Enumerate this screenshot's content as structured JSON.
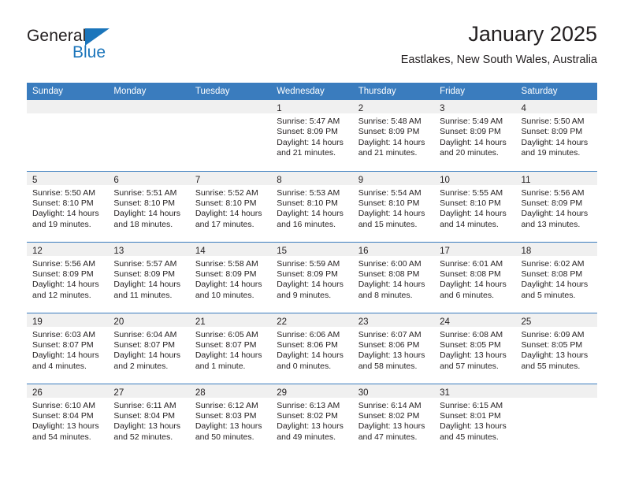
{
  "brand": {
    "name_top": "General",
    "name_bottom": "Blue",
    "accent_color": "#1b75bb",
    "triangle_icon": "triangle-icon"
  },
  "header": {
    "title": "January 2025",
    "subtitle": "Eastlakes, New South Wales, Australia"
  },
  "theme": {
    "header_row_bg": "#3a7cbe",
    "daynum_strip_bg": "#f0f0f0",
    "text_color": "#231f20",
    "row_divider": "#3a7cbe"
  },
  "weekday_headers": [
    "Sunday",
    "Monday",
    "Tuesday",
    "Wednesday",
    "Thursday",
    "Friday",
    "Saturday"
  ],
  "labels": {
    "sunrise_prefix": "Sunrise:",
    "sunset_prefix": "Sunset:",
    "daylight_prefix": "Daylight:"
  },
  "weeks": [
    [
      {
        "day": "",
        "empty": true,
        "lines": []
      },
      {
        "day": "",
        "empty": true,
        "lines": []
      },
      {
        "day": "",
        "empty": true,
        "lines": []
      },
      {
        "day": "1",
        "empty": false,
        "lines": [
          "Sunrise: 5:47 AM",
          "Sunset: 8:09 PM",
          "Daylight: 14 hours",
          "and 21 minutes."
        ]
      },
      {
        "day": "2",
        "empty": false,
        "lines": [
          "Sunrise: 5:48 AM",
          "Sunset: 8:09 PM",
          "Daylight: 14 hours",
          "and 21 minutes."
        ]
      },
      {
        "day": "3",
        "empty": false,
        "lines": [
          "Sunrise: 5:49 AM",
          "Sunset: 8:09 PM",
          "Daylight: 14 hours",
          "and 20 minutes."
        ]
      },
      {
        "day": "4",
        "empty": false,
        "lines": [
          "Sunrise: 5:50 AM",
          "Sunset: 8:09 PM",
          "Daylight: 14 hours",
          "and 19 minutes."
        ]
      }
    ],
    [
      {
        "day": "5",
        "empty": false,
        "lines": [
          "Sunrise: 5:50 AM",
          "Sunset: 8:10 PM",
          "Daylight: 14 hours",
          "and 19 minutes."
        ]
      },
      {
        "day": "6",
        "empty": false,
        "lines": [
          "Sunrise: 5:51 AM",
          "Sunset: 8:10 PM",
          "Daylight: 14 hours",
          "and 18 minutes."
        ]
      },
      {
        "day": "7",
        "empty": false,
        "lines": [
          "Sunrise: 5:52 AM",
          "Sunset: 8:10 PM",
          "Daylight: 14 hours",
          "and 17 minutes."
        ]
      },
      {
        "day": "8",
        "empty": false,
        "lines": [
          "Sunrise: 5:53 AM",
          "Sunset: 8:10 PM",
          "Daylight: 14 hours",
          "and 16 minutes."
        ]
      },
      {
        "day": "9",
        "empty": false,
        "lines": [
          "Sunrise: 5:54 AM",
          "Sunset: 8:10 PM",
          "Daylight: 14 hours",
          "and 15 minutes."
        ]
      },
      {
        "day": "10",
        "empty": false,
        "lines": [
          "Sunrise: 5:55 AM",
          "Sunset: 8:10 PM",
          "Daylight: 14 hours",
          "and 14 minutes."
        ]
      },
      {
        "day": "11",
        "empty": false,
        "lines": [
          "Sunrise: 5:56 AM",
          "Sunset: 8:09 PM",
          "Daylight: 14 hours",
          "and 13 minutes."
        ]
      }
    ],
    [
      {
        "day": "12",
        "empty": false,
        "lines": [
          "Sunrise: 5:56 AM",
          "Sunset: 8:09 PM",
          "Daylight: 14 hours",
          "and 12 minutes."
        ]
      },
      {
        "day": "13",
        "empty": false,
        "lines": [
          "Sunrise: 5:57 AM",
          "Sunset: 8:09 PM",
          "Daylight: 14 hours",
          "and 11 minutes."
        ]
      },
      {
        "day": "14",
        "empty": false,
        "lines": [
          "Sunrise: 5:58 AM",
          "Sunset: 8:09 PM",
          "Daylight: 14 hours",
          "and 10 minutes."
        ]
      },
      {
        "day": "15",
        "empty": false,
        "lines": [
          "Sunrise: 5:59 AM",
          "Sunset: 8:09 PM",
          "Daylight: 14 hours",
          "and 9 minutes."
        ]
      },
      {
        "day": "16",
        "empty": false,
        "lines": [
          "Sunrise: 6:00 AM",
          "Sunset: 8:08 PM",
          "Daylight: 14 hours",
          "and 8 minutes."
        ]
      },
      {
        "day": "17",
        "empty": false,
        "lines": [
          "Sunrise: 6:01 AM",
          "Sunset: 8:08 PM",
          "Daylight: 14 hours",
          "and 6 minutes."
        ]
      },
      {
        "day": "18",
        "empty": false,
        "lines": [
          "Sunrise: 6:02 AM",
          "Sunset: 8:08 PM",
          "Daylight: 14 hours",
          "and 5 minutes."
        ]
      }
    ],
    [
      {
        "day": "19",
        "empty": false,
        "lines": [
          "Sunrise: 6:03 AM",
          "Sunset: 8:07 PM",
          "Daylight: 14 hours",
          "and 4 minutes."
        ]
      },
      {
        "day": "20",
        "empty": false,
        "lines": [
          "Sunrise: 6:04 AM",
          "Sunset: 8:07 PM",
          "Daylight: 14 hours",
          "and 2 minutes."
        ]
      },
      {
        "day": "21",
        "empty": false,
        "lines": [
          "Sunrise: 6:05 AM",
          "Sunset: 8:07 PM",
          "Daylight: 14 hours",
          "and 1 minute."
        ]
      },
      {
        "day": "22",
        "empty": false,
        "lines": [
          "Sunrise: 6:06 AM",
          "Sunset: 8:06 PM",
          "Daylight: 14 hours",
          "and 0 minutes."
        ]
      },
      {
        "day": "23",
        "empty": false,
        "lines": [
          "Sunrise: 6:07 AM",
          "Sunset: 8:06 PM",
          "Daylight: 13 hours",
          "and 58 minutes."
        ]
      },
      {
        "day": "24",
        "empty": false,
        "lines": [
          "Sunrise: 6:08 AM",
          "Sunset: 8:05 PM",
          "Daylight: 13 hours",
          "and 57 minutes."
        ]
      },
      {
        "day": "25",
        "empty": false,
        "lines": [
          "Sunrise: 6:09 AM",
          "Sunset: 8:05 PM",
          "Daylight: 13 hours",
          "and 55 minutes."
        ]
      }
    ],
    [
      {
        "day": "26",
        "empty": false,
        "lines": [
          "Sunrise: 6:10 AM",
          "Sunset: 8:04 PM",
          "Daylight: 13 hours",
          "and 54 minutes."
        ]
      },
      {
        "day": "27",
        "empty": false,
        "lines": [
          "Sunrise: 6:11 AM",
          "Sunset: 8:04 PM",
          "Daylight: 13 hours",
          "and 52 minutes."
        ]
      },
      {
        "day": "28",
        "empty": false,
        "lines": [
          "Sunrise: 6:12 AM",
          "Sunset: 8:03 PM",
          "Daylight: 13 hours",
          "and 50 minutes."
        ]
      },
      {
        "day": "29",
        "empty": false,
        "lines": [
          "Sunrise: 6:13 AM",
          "Sunset: 8:02 PM",
          "Daylight: 13 hours",
          "and 49 minutes."
        ]
      },
      {
        "day": "30",
        "empty": false,
        "lines": [
          "Sunrise: 6:14 AM",
          "Sunset: 8:02 PM",
          "Daylight: 13 hours",
          "and 47 minutes."
        ]
      },
      {
        "day": "31",
        "empty": false,
        "lines": [
          "Sunrise: 6:15 AM",
          "Sunset: 8:01 PM",
          "Daylight: 13 hours",
          "and 45 minutes."
        ]
      },
      {
        "day": "",
        "empty": true,
        "lines": []
      }
    ]
  ]
}
